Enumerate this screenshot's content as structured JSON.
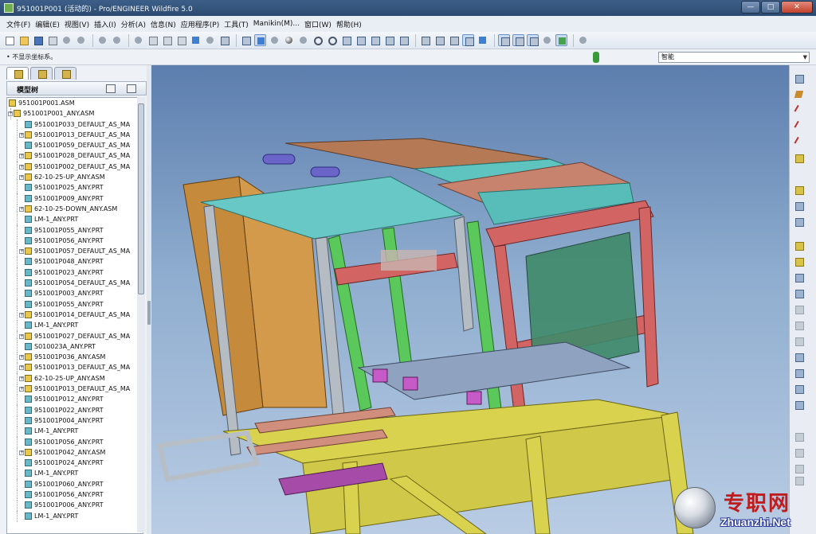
{
  "window": {
    "title": "951001P001 (活动的) - Pro/ENGINEER Wildfire 5.0",
    "minimize": "—",
    "maximize": "□",
    "close": "✕"
  },
  "menu": [
    "文件(F)",
    "编辑(E)",
    "视图(V)",
    "插入(I)",
    "分析(A)",
    "信息(N)",
    "应用程序(P)",
    "工具(T)",
    "Manikin(M)...",
    "窗口(W)",
    "帮助(H)"
  ],
  "status": {
    "message": "• 不显示坐标系。",
    "filter_value": "智能"
  },
  "left_panel": {
    "tree_title": "模型树",
    "items": [
      {
        "label": "951001P001.ASM",
        "type": "asm",
        "level": 0,
        "expandable": false
      },
      {
        "label": "951001P001_ANY.ASM",
        "type": "asm",
        "level": 1,
        "expandable": true
      },
      {
        "label": "951001P033_DEFAULT_AS_MA",
        "type": "prt",
        "level": 2,
        "expandable": false
      },
      {
        "label": "951001P013_DEFAULT_AS_MA",
        "type": "asm",
        "level": 2,
        "expandable": true
      },
      {
        "label": "951001P059_DEFAULT_AS_MA",
        "type": "prt",
        "level": 2,
        "expandable": false
      },
      {
        "label": "951001P028_DEFAULT_AS_MA",
        "type": "asm",
        "level": 2,
        "expandable": true
      },
      {
        "label": "951001P002_DEFAULT_AS_MA",
        "type": "asm",
        "level": 2,
        "expandable": true
      },
      {
        "label": "62-10-25-UP_ANY.ASM",
        "type": "asm",
        "level": 2,
        "expandable": true
      },
      {
        "label": "951001P025_ANY.PRT",
        "type": "prt",
        "level": 2,
        "expandable": false
      },
      {
        "label": "951001P009_ANY.PRT",
        "type": "prt",
        "level": 2,
        "expandable": false
      },
      {
        "label": "62-10-25-DOWN_ANY.ASM",
        "type": "asm",
        "level": 2,
        "expandable": true
      },
      {
        "label": "LM-1_ANY.PRT",
        "type": "prt",
        "level": 2,
        "expandable": false
      },
      {
        "label": "951001P055_ANY.PRT",
        "type": "prt",
        "level": 2,
        "expandable": false
      },
      {
        "label": "951001P056_ANY.PRT",
        "type": "prt",
        "level": 2,
        "expandable": false
      },
      {
        "label": "951001P057_DEFAULT_AS_MA",
        "type": "asm",
        "level": 2,
        "expandable": true
      },
      {
        "label": "951001P048_ANY.PRT",
        "type": "prt",
        "level": 2,
        "expandable": false
      },
      {
        "label": "951001P023_ANY.PRT",
        "type": "prt",
        "level": 2,
        "expandable": false
      },
      {
        "label": "951001P054_DEFAULT_AS_MA",
        "type": "prt",
        "level": 2,
        "expandable": false
      },
      {
        "label": "951001P003_ANY.PRT",
        "type": "prt",
        "level": 2,
        "expandable": false
      },
      {
        "label": "951001P055_ANY.PRT",
        "type": "prt",
        "level": 2,
        "expandable": false
      },
      {
        "label": "951001P014_DEFAULT_AS_MA",
        "type": "asm",
        "level": 2,
        "expandable": true
      },
      {
        "label": "LM-1_ANY.PRT",
        "type": "prt",
        "level": 2,
        "expandable": false
      },
      {
        "label": "951001P027_DEFAULT_AS_MA",
        "type": "asm",
        "level": 2,
        "expandable": true
      },
      {
        "label": "S010023A_ANY.PRT",
        "type": "prt",
        "level": 2,
        "expandable": false
      },
      {
        "label": "951001P036_ANY.ASM",
        "type": "asm",
        "level": 2,
        "expandable": true
      },
      {
        "label": "951001P013_DEFAULT_AS_MA",
        "type": "asm",
        "level": 2,
        "expandable": true
      },
      {
        "label": "62-10-25-UP_ANY.ASM",
        "type": "asm",
        "level": 2,
        "expandable": true
      },
      {
        "label": "951001P013_DEFAULT_AS_MA",
        "type": "asm",
        "level": 2,
        "expandable": true
      },
      {
        "label": "951001P012_ANY.PRT",
        "type": "prt",
        "level": 2,
        "expandable": false
      },
      {
        "label": "951001P022_ANY.PRT",
        "type": "prt",
        "level": 2,
        "expandable": false
      },
      {
        "label": "951001P004_ANY.PRT",
        "type": "prt",
        "level": 2,
        "expandable": false
      },
      {
        "label": "LM-1_ANY.PRT",
        "type": "prt",
        "level": 2,
        "expandable": false
      },
      {
        "label": "951001P056_ANY.PRT",
        "type": "prt",
        "level": 2,
        "expandable": false
      },
      {
        "label": "951001P042_ANY.ASM",
        "type": "asm",
        "level": 2,
        "expandable": true
      },
      {
        "label": "951001P024_ANY.PRT",
        "type": "prt",
        "level": 2,
        "expandable": false
      },
      {
        "label": "LM-1_ANY.PRT",
        "type": "prt",
        "level": 2,
        "expandable": false
      },
      {
        "label": "951001P060_ANY.PRT",
        "type": "prt",
        "level": 2,
        "expandable": false
      },
      {
        "label": "951001P056_ANY.PRT",
        "type": "prt",
        "level": 2,
        "expandable": false
      },
      {
        "label": "951001P006_ANY.PRT",
        "type": "prt",
        "level": 2,
        "expandable": false
      },
      {
        "label": "LM-1_ANY.PRT",
        "type": "prt",
        "level": 2,
        "expandable": false
      }
    ]
  },
  "watermark": {
    "cn": "专职网",
    "en": "Zhuanzhi.Net"
  }
}
